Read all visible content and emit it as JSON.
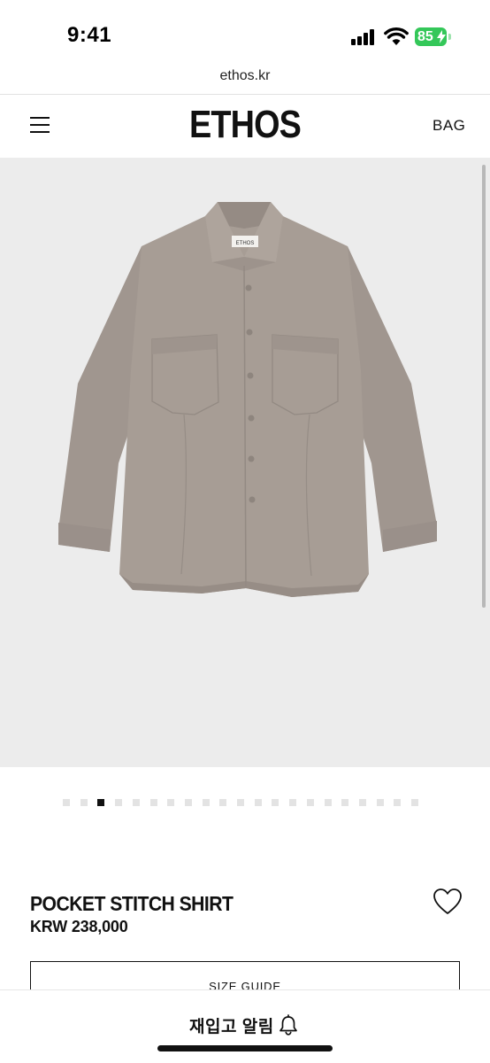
{
  "status_bar": {
    "time": "9:41",
    "battery_level": "85",
    "icons": [
      "cellular-signal-icon",
      "wifi-icon",
      "battery-charging-icon"
    ]
  },
  "browser": {
    "url": "ethos.kr"
  },
  "header": {
    "logo": "ETHOS",
    "bag_label": "BAG",
    "menu_icon": "hamburger-menu-icon"
  },
  "product": {
    "image_description_icon": "gray-pocket-shirt-image",
    "shirt_tag": "ETHOS",
    "name": "POCKET STITCH SHIRT",
    "price": "KRW 238,000",
    "image_count": 21,
    "active_image_index": 2,
    "wishlist_icon": "heart-icon"
  },
  "size_guide": {
    "label": "SIZE GUIDE"
  },
  "bottom_bar": {
    "restock_label": "재입고 알림",
    "icon": "bell-icon"
  },
  "colors": {
    "image_background": "#ececec",
    "shirt": "#a49a93",
    "battery": "#34c759",
    "text": "#111111"
  }
}
